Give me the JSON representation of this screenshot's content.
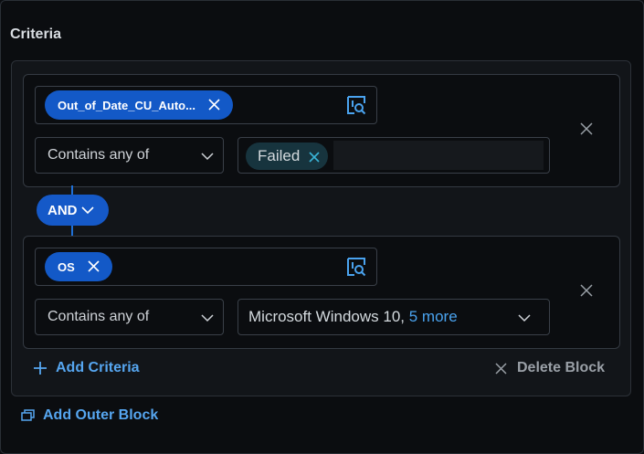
{
  "title": "Criteria",
  "blocks": [
    {
      "field": "Out_of_Date_CU_Auto...",
      "operator": "Contains any of",
      "value_chip": "Failed"
    },
    {
      "field": "OS",
      "operator": "Contains any of",
      "value_text": "Microsoft Windows 10, ",
      "value_more": "5 more"
    }
  ],
  "logic": {
    "label": "AND"
  },
  "actions": {
    "add_criteria": "Add Criteria",
    "delete_block": "Delete Block",
    "add_outer_block": "Add Outer Block"
  },
  "colors": {
    "accent": "#1359c7",
    "link": "#56a6f0",
    "background": "#0b0d10"
  },
  "icons": [
    "close-icon",
    "field-picker-icon",
    "chevron-down-icon",
    "plus-icon",
    "outer-block-icon"
  ]
}
